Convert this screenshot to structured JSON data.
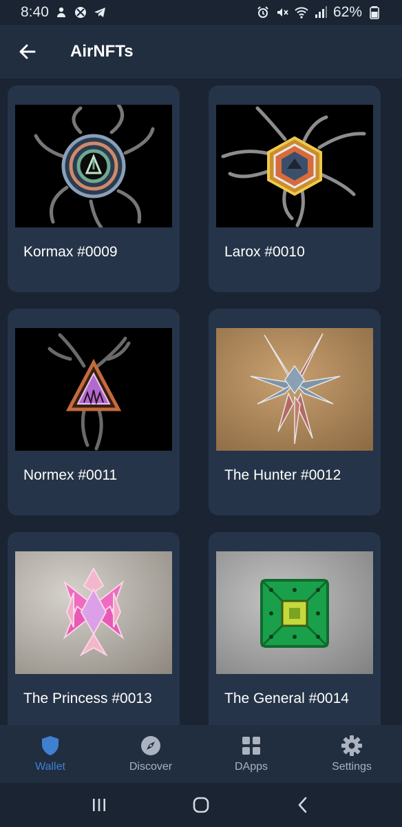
{
  "status_bar": {
    "time": "8:40",
    "battery": "62%",
    "left_icons": [
      "notification-person-icon",
      "xbox-icon",
      "telegram-icon"
    ],
    "right_icons": [
      "alarm-icon",
      "mute-icon",
      "wifi-icon",
      "signal-icon",
      "battery-icon"
    ]
  },
  "app_bar": {
    "title": "AirNFTs",
    "back_icon": "back-arrow-icon"
  },
  "nfts": [
    {
      "name": "Kormax #0009",
      "background": "#000000"
    },
    {
      "name": "Larox #0010",
      "background": "#000000"
    },
    {
      "name": "Normex #0011",
      "background": "#000000"
    },
    {
      "name": "The Hunter #0012",
      "background": "#b0895d"
    },
    {
      "name": "The Princess #0013",
      "background": "#a9a39b"
    },
    {
      "name": "The General #0014",
      "background": "#a0a0a0"
    }
  ],
  "bottom_nav": {
    "items": [
      {
        "label": "Wallet",
        "icon": "shield-icon",
        "active": true
      },
      {
        "label": "Discover",
        "icon": "compass-icon",
        "active": false
      },
      {
        "label": "DApps",
        "icon": "grid-icon",
        "active": false
      },
      {
        "label": "Settings",
        "icon": "gear-icon",
        "active": false
      }
    ]
  },
  "system_nav": {
    "icons": [
      "recent-apps-icon",
      "home-icon",
      "back-icon"
    ]
  },
  "colors": {
    "background": "#1a2433",
    "app_bar": "#212e40",
    "card": "#253448",
    "accent": "#3f80d1",
    "inactive": "#aab3bf"
  }
}
